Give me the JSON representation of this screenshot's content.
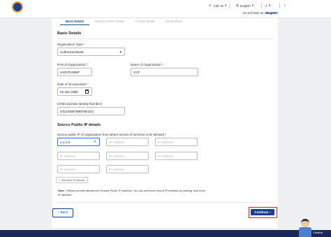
{
  "header": {
    "logo_text": "",
    "call_us": "Call Us",
    "language": "English",
    "no_account_text": "Do not have an account?",
    "register_label": "Register"
  },
  "tabs": [
    {
      "label": "Basic Details",
      "active": true
    },
    {
      "label": "Resource MNC details",
      "active": false
    },
    {
      "label": "Contact details",
      "active": false
    },
    {
      "label": "Declarations",
      "active": false
    }
  ],
  "basic_details": {
    "title": "Basic Details",
    "org_type_label": "Organization Type",
    "org_type_value": "Authorized Bank",
    "pan_label": "PAN of Organization",
    "pan_value": "UIOCP1005P",
    "name_label": "Name of Organization",
    "name_value": "XYZ",
    "doi_label": "Date of incorporation",
    "doi_value": "01-Jan-1990",
    "cin_label": "CIN(Corporate Identity Number)",
    "cin_value": "mf12345678987654321"
  },
  "ip_details": {
    "title": "Source Public IP details",
    "label": "Source public IP of organization from where access of services to be allowed",
    "ip1_value": "1.1.1.5",
    "ip_placeholder": "IP Address",
    "add_more_label": "Add More IP Address",
    "note_prefix": "Note :",
    "note_text": "Please provide atleast one Source Public IP address. You can add more than 8 IP address by clicking 'Add more IP address'"
  },
  "actions": {
    "back_label": "Back",
    "continue_label": "Continue"
  },
  "chatbot_label": "Chatbot",
  "colors": {
    "primary": "#1d3f8f",
    "highlight": "#d31e2d",
    "footer": "#1a2a55"
  }
}
